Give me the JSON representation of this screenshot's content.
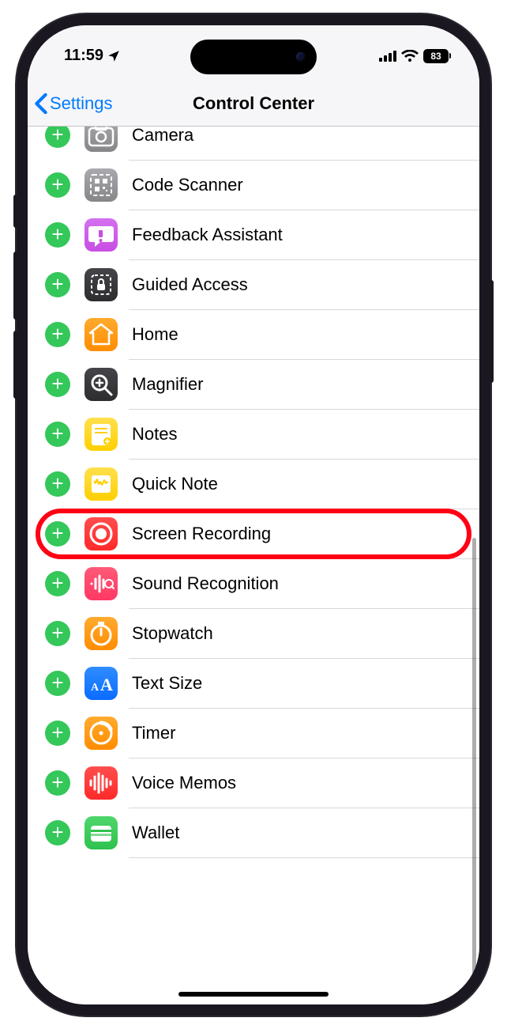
{
  "status": {
    "time": "11:59",
    "battery": "83"
  },
  "nav": {
    "back": "Settings",
    "title": "Control Center"
  },
  "items": [
    {
      "name": "camera",
      "label": "Camera",
      "icon_bg": "ic-gray",
      "icon": "camera",
      "highlight": false
    },
    {
      "name": "code-scanner",
      "label": "Code Scanner",
      "icon_bg": "ic-gray",
      "icon": "qr",
      "highlight": false
    },
    {
      "name": "feedback",
      "label": "Feedback Assistant",
      "icon_bg": "ic-purple",
      "icon": "bubble",
      "highlight": false
    },
    {
      "name": "guided-access",
      "label": "Guided Access",
      "icon_bg": "ic-dark",
      "icon": "lock-dashed",
      "highlight": false
    },
    {
      "name": "home",
      "label": "Home",
      "icon_bg": "ic-orange",
      "icon": "house",
      "highlight": false
    },
    {
      "name": "magnifier",
      "label": "Magnifier",
      "icon_bg": "ic-dark",
      "icon": "zoom",
      "highlight": false
    },
    {
      "name": "notes",
      "label": "Notes",
      "icon_bg": "ic-yellow",
      "icon": "note",
      "highlight": false
    },
    {
      "name": "quick-note",
      "label": "Quick Note",
      "icon_bg": "ic-yellow",
      "icon": "quicknote",
      "highlight": false
    },
    {
      "name": "screen-recording",
      "label": "Screen Recording",
      "icon_bg": "ic-red",
      "icon": "record",
      "highlight": true
    },
    {
      "name": "sound-recognition",
      "label": "Sound Recognition",
      "icon_bg": "ic-pink",
      "icon": "soundwave",
      "highlight": false
    },
    {
      "name": "stopwatch",
      "label": "Stopwatch",
      "icon_bg": "ic-orange",
      "icon": "stopwatch",
      "highlight": false
    },
    {
      "name": "text-size",
      "label": "Text Size",
      "icon_bg": "ic-blue",
      "icon": "textsize",
      "highlight": false
    },
    {
      "name": "timer",
      "label": "Timer",
      "icon_bg": "ic-orange",
      "icon": "timer",
      "highlight": false
    },
    {
      "name": "voice-memos",
      "label": "Voice Memos",
      "icon_bg": "ic-red",
      "icon": "waveform",
      "highlight": false
    },
    {
      "name": "wallet",
      "label": "Wallet",
      "icon_bg": "ic-green",
      "icon": "wallet",
      "highlight": false
    }
  ]
}
